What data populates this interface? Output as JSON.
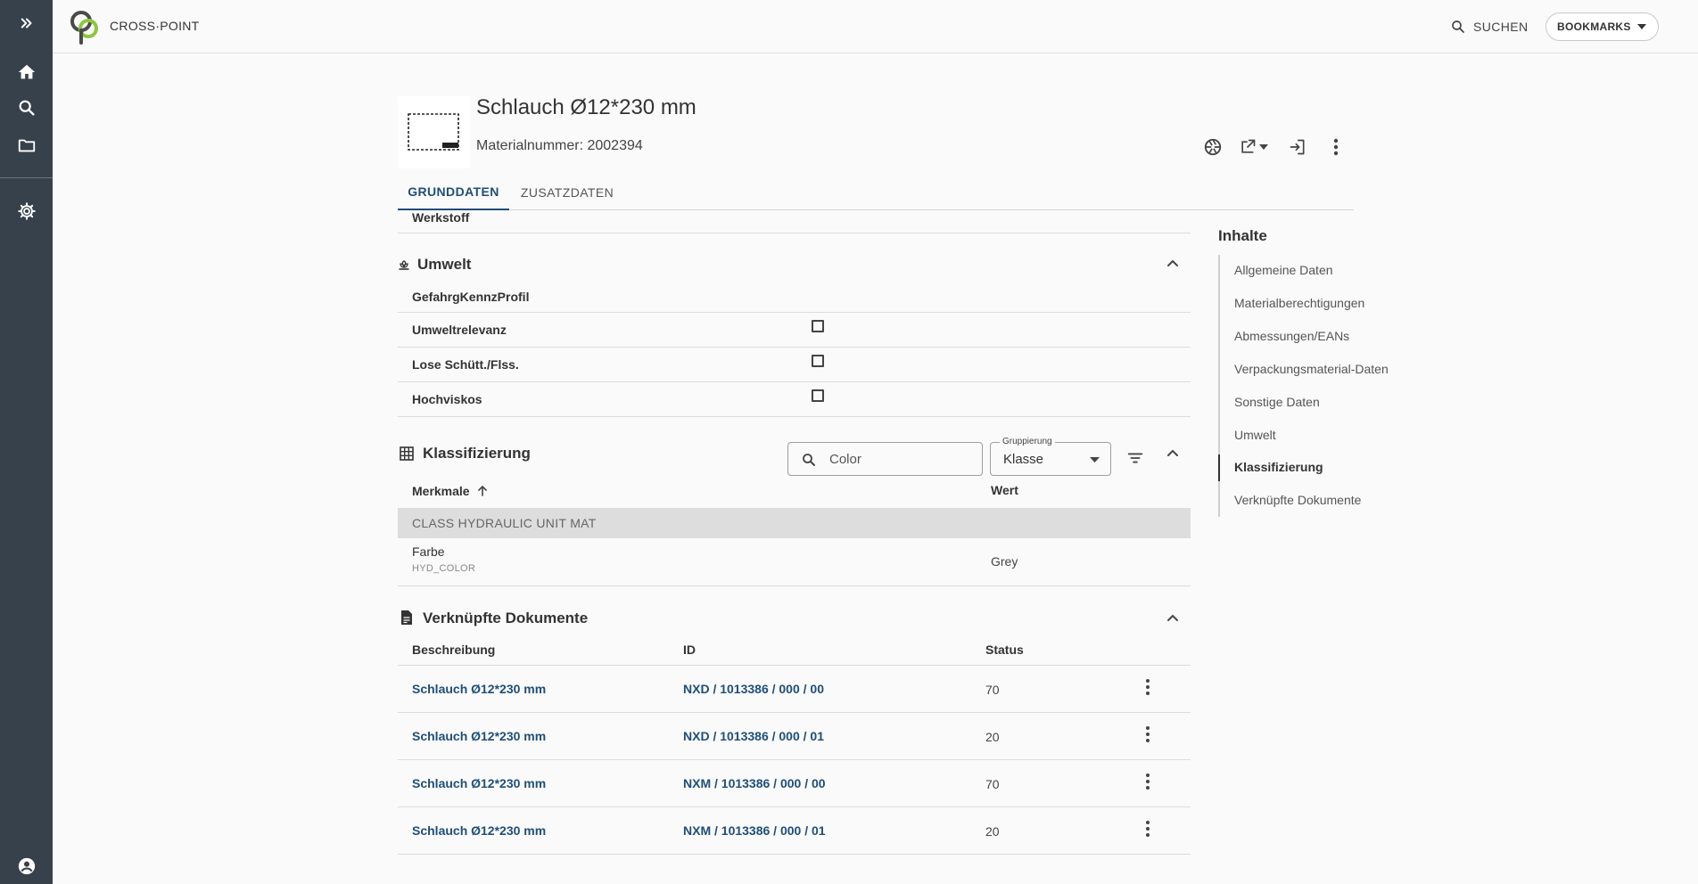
{
  "header": {
    "brand": "CROSS·POINT",
    "search_label": "SUCHEN",
    "bookmarks_label": "BOOKMARKS"
  },
  "material": {
    "title": "Schlauch Ø12*230 mm",
    "number": "Materialnummer: 2002394"
  },
  "tabs": [
    {
      "label": "GRUNDDATEN",
      "active": true
    },
    {
      "label": "ZUSATZDATEN",
      "active": false
    }
  ],
  "werkstoff_label": "Werkstoff",
  "umwelt": {
    "title": "Umwelt",
    "profile_label": "GefahrgKennzProfil",
    "rows": [
      {
        "label": "Umweltrelevanz",
        "checked": false
      },
      {
        "label": "Lose Schütt./Flss.",
        "checked": false
      },
      {
        "label": "Hochviskos",
        "checked": false
      }
    ]
  },
  "klassifizierung": {
    "title": "Klassifizierung",
    "search_value": "Color",
    "grouping_label": "Gruppierung",
    "grouping_value": "Klasse",
    "col_merkmale": "Merkmale",
    "col_wert": "Wert",
    "group": "CLASS HYDRAULIC UNIT MAT",
    "items": [
      {
        "name": "Farbe",
        "code": "HYD_COLOR",
        "value": "Grey"
      }
    ]
  },
  "dokumente": {
    "title": "Verknüpfte Dokumente",
    "col_beschreibung": "Beschreibung",
    "col_id": "ID",
    "col_status": "Status",
    "rows": [
      {
        "desc": "Schlauch Ø12*230 mm",
        "id": "NXD / 1013386 / 000 / 00",
        "status": "70"
      },
      {
        "desc": "Schlauch Ø12*230 mm",
        "id": "NXD / 1013386 / 000 / 01",
        "status": "20"
      },
      {
        "desc": "Schlauch Ø12*230 mm",
        "id": "NXM / 1013386 / 000 / 00",
        "status": "70"
      },
      {
        "desc": "Schlauch Ø12*230 mm",
        "id": "NXM / 1013386 / 000 / 01",
        "status": "20"
      }
    ]
  },
  "toc": {
    "title": "Inhalte",
    "items": [
      {
        "label": "Allgemeine Daten",
        "active": false
      },
      {
        "label": "Materialberechtigungen",
        "active": false
      },
      {
        "label": "Abmessungen/EANs",
        "active": false
      },
      {
        "label": "Verpackungsmaterial-Daten",
        "active": false
      },
      {
        "label": "Sonstige Daten",
        "active": false
      },
      {
        "label": "Umwelt",
        "active": false
      },
      {
        "label": "Klassifizierung",
        "active": true
      },
      {
        "label": "Verknüpfte Dokumente",
        "active": false
      }
    ]
  },
  "colors": {
    "rail": "#37414b",
    "link": "#1f4e79",
    "logo_dark": "#4a4a4a",
    "logo_green": "#8dc63f"
  }
}
